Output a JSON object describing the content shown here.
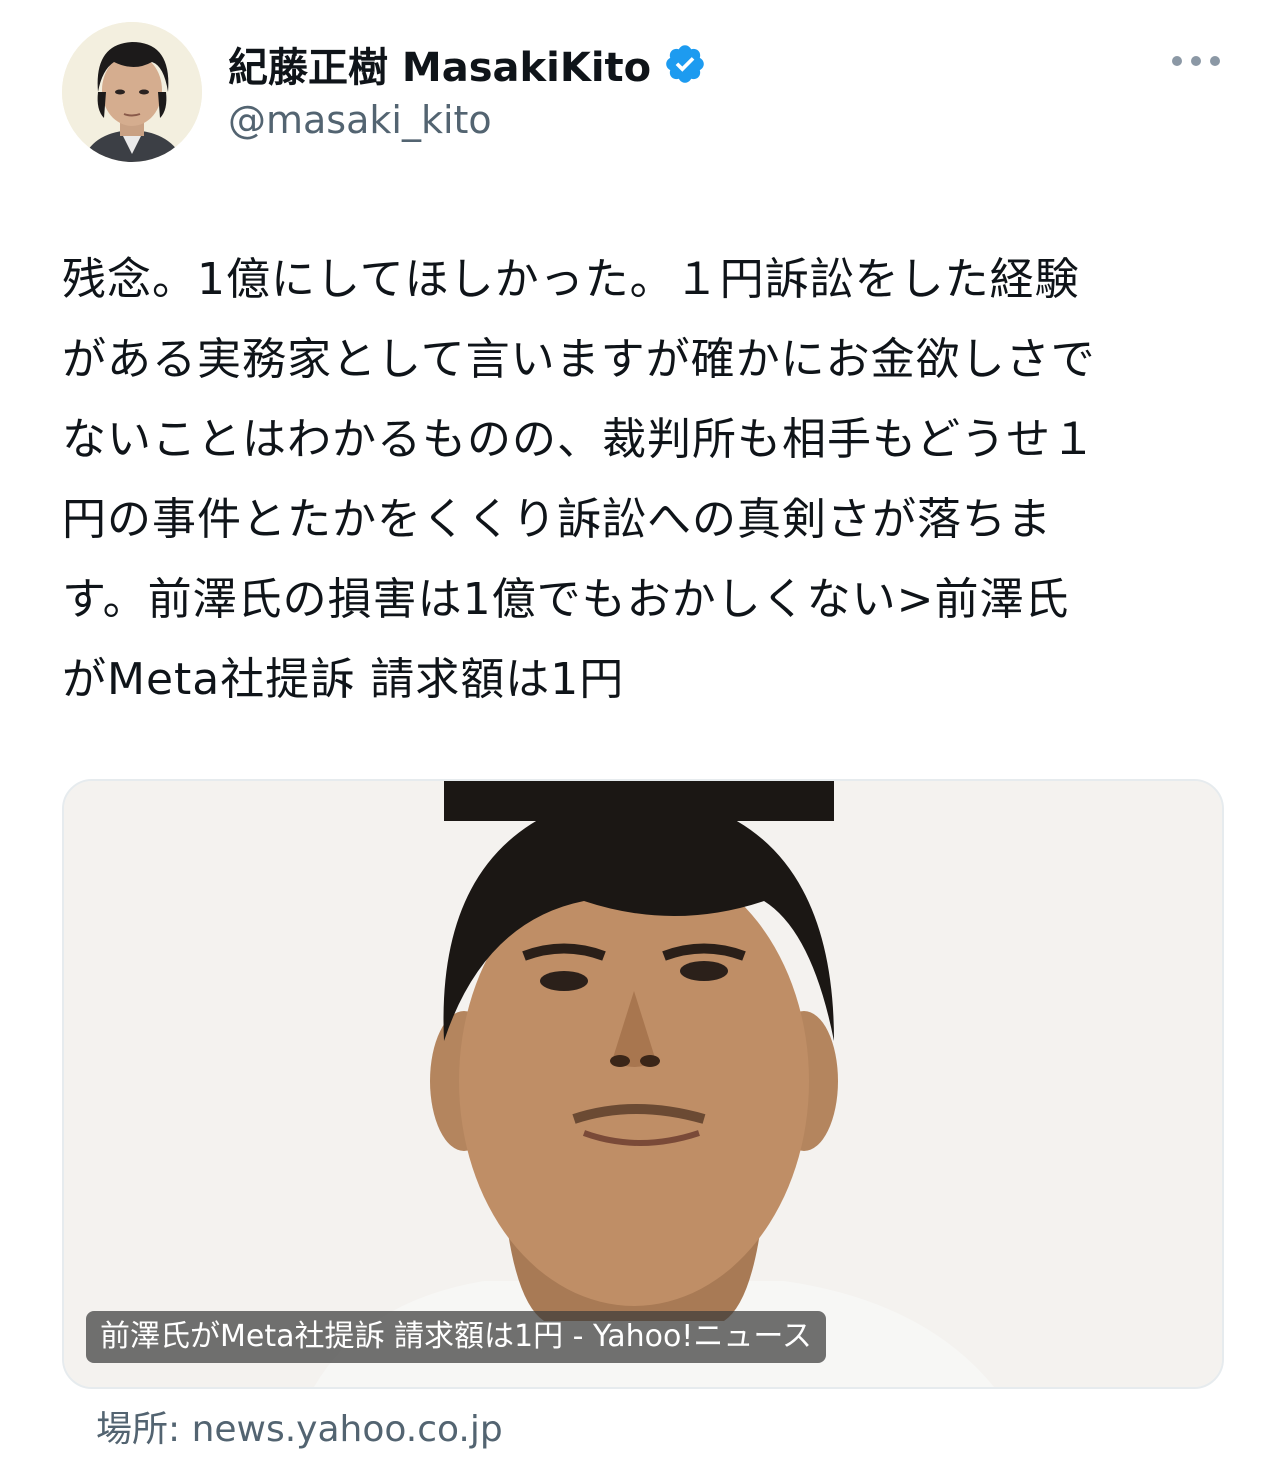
{
  "author": {
    "display_name": "紀藤正樹 MasakiKito",
    "handle": "@masaki_kito",
    "verified": true,
    "avatar_icon": "author-avatar",
    "verified_color": "#1d9bf0"
  },
  "menu": {
    "more_icon": "more-horizontal-icon"
  },
  "tweet": {
    "lines": [
      "残念。1億にしてほしかった。１円訴訟をした経験",
      "がある実務家として言いますが確かにお金欲しさで",
      "ないことはわかるものの、裁判所も相手もどうせ１",
      "円の事件とたかをくくり訴訟への真剣さが落ちま",
      "す。前澤氏の損害は1億でもおかしくない>前澤氏",
      "がMeta社提訴 請求額は1円"
    ]
  },
  "link_card": {
    "image_icon": "news-photo-image",
    "caption": "前澤氏がMeta社提訴 請求額は1円 - Yahoo!ニュース",
    "source": "場所: news.yahoo.co.jp"
  },
  "colors": {
    "text": "#0f1419",
    "secondary": "#536471",
    "border": "#e6ebee"
  }
}
